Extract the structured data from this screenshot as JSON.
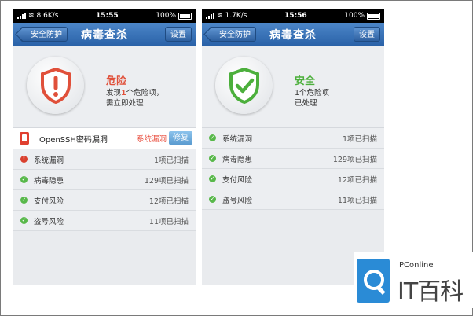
{
  "screens": [
    {
      "statusbar": {
        "signal": "signal-bars",
        "network": "8.6K/s",
        "time": "15:55",
        "battery": "100%"
      },
      "nav": {
        "back_label": "安全防护",
        "title": "病毒查杀",
        "settings_label": "设置",
        "color": "#2a62a8"
      },
      "hero": {
        "status": "危险",
        "status_color": "#e0503a",
        "icon": "danger-shield-icon",
        "desc_prefix": "发现",
        "desc_num": "1",
        "desc_mid": "个危险项，",
        "desc_line2": "需立即处理"
      },
      "alert": {
        "icon": "phone-alert-icon",
        "name": "OpenSSH密码漏洞",
        "type": "系统漏洞",
        "action": "修复"
      },
      "items": [
        {
          "icon": "warning-icon",
          "label": "系统漏洞",
          "count": "1项已扫描"
        },
        {
          "icon": "check-icon",
          "label": "病毒隐患",
          "count": "129项已扫描"
        },
        {
          "icon": "check-icon",
          "label": "支付风险",
          "count": "12项已扫描"
        },
        {
          "icon": "check-icon",
          "label": "盗号风险",
          "count": "11项已扫描"
        }
      ]
    },
    {
      "statusbar": {
        "signal": "signal-bars",
        "network": "1.7K/s",
        "time": "15:56",
        "battery": "100%"
      },
      "nav": {
        "back_label": "安全防护",
        "title": "病毒查杀",
        "settings_label": "设置",
        "color": "#2a62a8"
      },
      "hero": {
        "status": "安全",
        "status_color": "#4caf3c",
        "icon": "safe-shield-check-icon",
        "desc_line1": "1个危险项",
        "desc_line2": "已处理"
      },
      "items": [
        {
          "icon": "check-icon",
          "label": "系统漏洞",
          "count": "1项已扫描"
        },
        {
          "icon": "check-icon",
          "label": "病毒隐患",
          "count": "129项已扫描"
        },
        {
          "icon": "check-icon",
          "label": "支付风险",
          "count": "12项已扫描"
        },
        {
          "icon": "check-icon",
          "label": "盗号风险",
          "count": "11项已扫描"
        }
      ]
    }
  ],
  "watermark": {
    "brand": "PConline",
    "logo_text": "IT百科",
    "logo_color": "#2a8bd6"
  }
}
